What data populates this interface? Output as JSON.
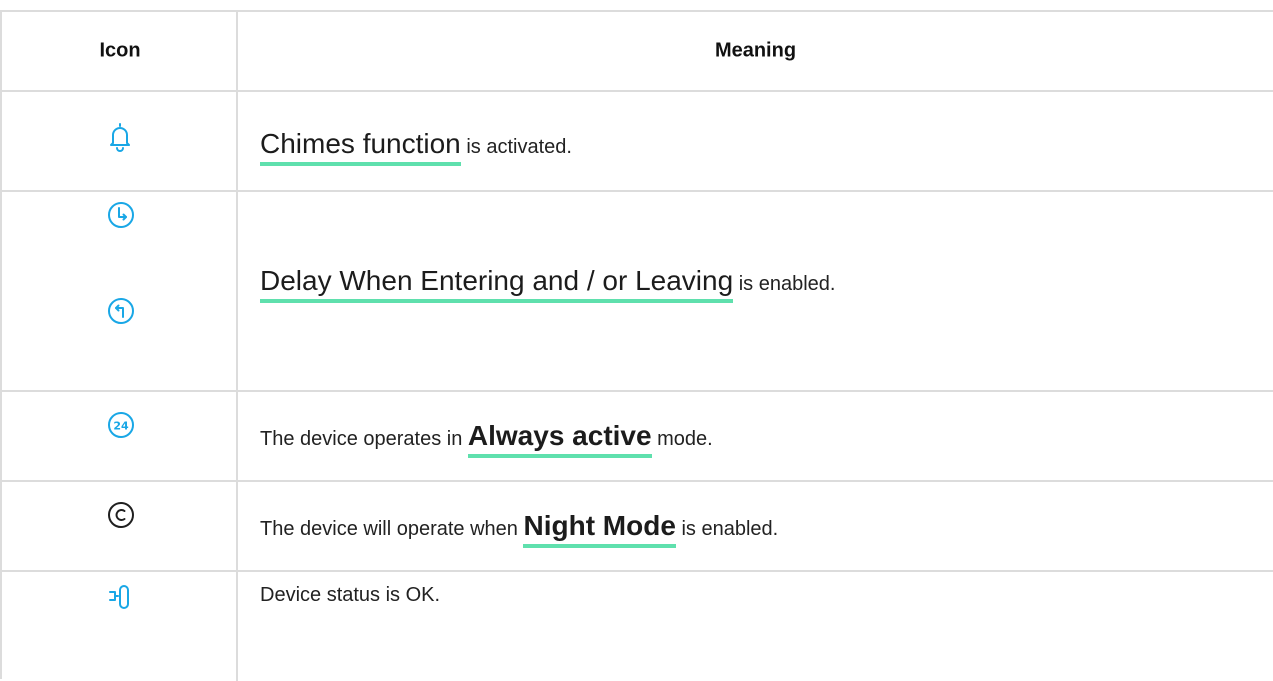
{
  "header": {
    "icon_label": "Icon",
    "meaning_label": "Meaning"
  },
  "colors": {
    "accent_blue": "#19a7e6",
    "link_underline": "#5fe0ad",
    "icon_dark": "#1f1f1f",
    "border": "#dcdcdc"
  },
  "rows": [
    {
      "icons": [
        "bell-icon"
      ],
      "prefix": "",
      "link": "Chimes function",
      "suffix": " is activated."
    },
    {
      "icons": [
        "clock-delay-entering-icon",
        "clock-delay-leaving-icon"
      ],
      "prefix": "",
      "link": "Delay When Entering and / or Leaving",
      "suffix": " is enabled."
    },
    {
      "icons": [
        "always-active-24-icon"
      ],
      "icon_text": "24",
      "prefix": "The device operates in ",
      "link": "Always active",
      "suffix": " mode."
    },
    {
      "icons": [
        "night-mode-icon"
      ],
      "prefix": "The device will operate when ",
      "link": "Night Mode",
      "suffix": " is enabled."
    },
    {
      "icons": [
        "device-status-ok-icon"
      ],
      "prefix": "Device status is OK.",
      "link": "",
      "suffix": ""
    }
  ]
}
